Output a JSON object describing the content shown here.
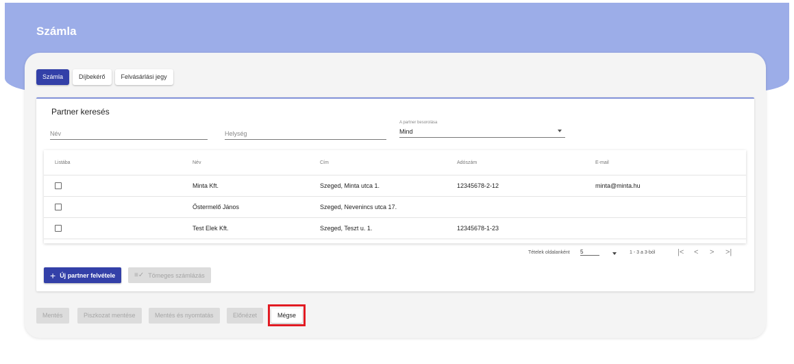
{
  "app": {
    "title": "Számla"
  },
  "tabs": [
    {
      "label": "Számla",
      "active": true
    },
    {
      "label": "Díjbekérő",
      "active": false
    },
    {
      "label": "Felvásárlási jegy",
      "active": false
    }
  ],
  "partner_search": {
    "title": "Partner keresés",
    "name_placeholder": "Név",
    "city_placeholder": "Helység",
    "classification_label": "A partner besorolása",
    "classification_value": "Mind"
  },
  "table": {
    "headers": [
      "Listába",
      "Név",
      "Cím",
      "Adószám",
      "E-mail"
    ],
    "rows": [
      {
        "checked": false,
        "name": "Minta Kft.",
        "address": "Szeged, Minta utca 1.",
        "tax_id": "12345678-2-12",
        "email": "minta@minta.hu"
      },
      {
        "checked": false,
        "name": "Őstermelő János",
        "address": "Szeged, Nevenincs utca 17.",
        "tax_id": "",
        "email": ""
      },
      {
        "checked": false,
        "name": "Test Elek Kft.",
        "address": "Szeged, Teszt u. 1.",
        "tax_id": "12345678-1-23",
        "email": ""
      }
    ]
  },
  "pagination": {
    "items_per_page_label": "Tételek oldalanként",
    "page_size": "5",
    "range_text": "1 - 3 a 3-ból",
    "first": "|<",
    "prev": "<",
    "next": ">",
    "last": ">|"
  },
  "actions": {
    "new_partner": "Új partner felvétele",
    "bulk_invoice": "Tömeges számlázás"
  },
  "footer_buttons": {
    "save": "Mentés",
    "save_draft": "Piszkozat mentése",
    "save_print": "Mentés és nyomtatás",
    "preview": "Előnézet",
    "cancel": "Mégse"
  },
  "colors": {
    "header": "#9cade8",
    "primary": "#3340a8",
    "highlight": "#e21b23"
  }
}
